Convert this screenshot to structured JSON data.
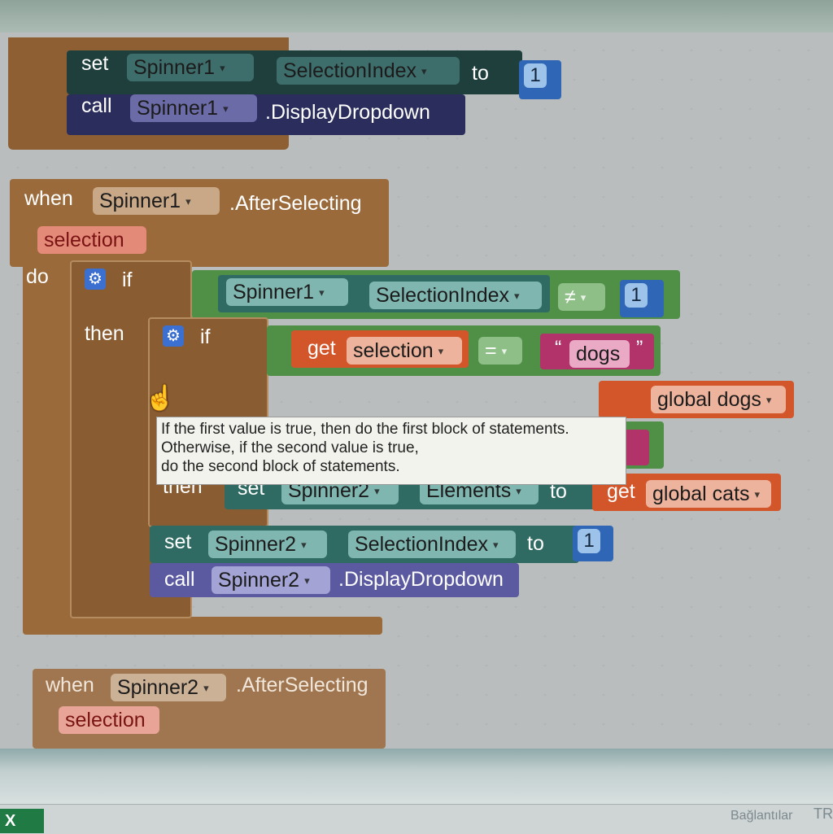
{
  "block1": {
    "set_kw": "set",
    "set_comp": "Spinner1",
    "set_prop": "SelectionIndex",
    "to_kw": "to",
    "set_value": "1",
    "call_kw": "call",
    "call_comp": "Spinner1",
    "call_method": ".DisplayDropdown"
  },
  "event1": {
    "when_kw": "when",
    "component": "Spinner1",
    "event": ".AfterSelecting",
    "param": "selection",
    "do_kw": "do",
    "if_kw": "if",
    "cond_comp": "Spinner1",
    "cond_prop": "SelectionIndex",
    "cond_op": "≠",
    "cond_value": "1",
    "then_kw": "then",
    "inner_if_kw": "if",
    "get_kw": "get",
    "get_var": "selection",
    "eq_op": "=",
    "str_value": "dogs",
    "get2_var": "global dogs",
    "inner_then_kw": "then",
    "set2_kw": "set",
    "set2_comp": "Spinner2",
    "set2_prop": "Elements",
    "to2_kw": "to",
    "get3_kw": "get",
    "get3_var": "global cats",
    "set3_kw": "set",
    "set3_comp": "Spinner2",
    "set3_prop": "SelectionIndex",
    "to3_kw": "to",
    "set3_value": "1",
    "call2_kw": "call",
    "call2_comp": "Spinner2",
    "call2_method": ".DisplayDropdown"
  },
  "event2": {
    "when_kw": "when",
    "component": "Spinner2",
    "event": ".AfterSelecting",
    "param": "selection"
  },
  "tooltip": {
    "line1": "If the first value is true, then do the first block of statements.",
    "line2": "Otherwise, if the second value is true,",
    "line3": "do the second block of statements."
  },
  "taskbar": {
    "excel_label": "X",
    "status": "Bağlantılar",
    "lang": "TR"
  },
  "colors": {
    "event_brown": "#9b6a3b",
    "set_teal": "#2f6b62",
    "call_purple": "#5b5aa0",
    "get_orange": "#d2562a",
    "logic_green": "#4f8f46",
    "text_magenta": "#b1336a",
    "math_blue": "#2f66b6"
  }
}
